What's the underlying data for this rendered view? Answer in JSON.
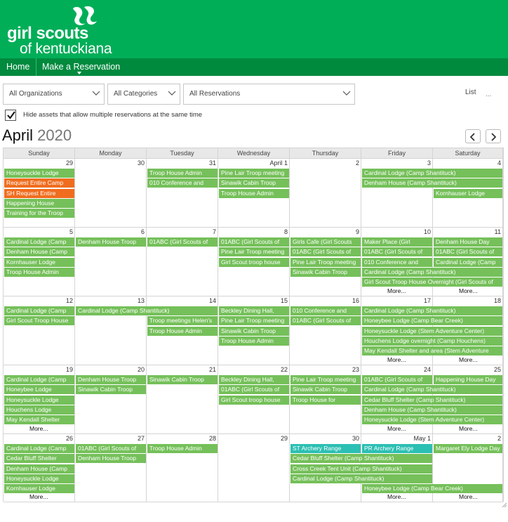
{
  "brand": {
    "line1": "girl scouts",
    "line2": "of kentuckiana"
  },
  "nav": {
    "home": "Home",
    "reserve": "Make a Reservation"
  },
  "filters": {
    "organizations": "All Organizations",
    "categories": "All Categories",
    "reservations": "All Reservations",
    "list": "List",
    "more_dots": "..."
  },
  "hide_assets": {
    "label": "Hide assets that allow multiple reservations at the same time",
    "checked": true
  },
  "month": {
    "name": "April",
    "year": "2020"
  },
  "colors": {
    "header": "#00ae58",
    "nav": "#008a3e",
    "event": "#75c05a",
    "event_alert": "#f06d1f",
    "event_teal": "#2cbfb3"
  },
  "days": [
    "Sunday",
    "Monday",
    "Tuesday",
    "Wednesday",
    "Thursday",
    "Friday",
    "Saturday"
  ],
  "weeks": [
    {
      "dates": [
        "29",
        "30",
        "31",
        "April 1",
        "2",
        "3",
        "4"
      ],
      "events": [
        {
          "c": 0,
          "s": 1,
          "r": 0,
          "t": "Honeysuckle Lodge",
          "k": "g"
        },
        {
          "c": 0,
          "s": 1,
          "r": 1,
          "t": "Request Entire Camp",
          "k": "o"
        },
        {
          "c": 0,
          "s": 1,
          "r": 2,
          "t": "SH Request Entire",
          "k": "o"
        },
        {
          "c": 0,
          "s": 1,
          "r": 3,
          "t": "Happening House",
          "k": "g"
        },
        {
          "c": 0,
          "s": 1,
          "r": 4,
          "t": "Training for the Troop",
          "k": "g"
        },
        {
          "c": 2,
          "s": 1,
          "r": 0,
          "t": "Troop House Admin",
          "k": "g"
        },
        {
          "c": 2,
          "s": 1,
          "r": 1,
          "t": "010 Conference and",
          "k": "g"
        },
        {
          "c": 3,
          "s": 1,
          "r": 0,
          "t": "Pine Lair Troop meeting",
          "k": "g"
        },
        {
          "c": 3,
          "s": 1,
          "r": 1,
          "t": "Sinawik Cabin Troop",
          "k": "g"
        },
        {
          "c": 3,
          "s": 1,
          "r": 2,
          "t": "Troop House Admin",
          "k": "g"
        },
        {
          "c": 5,
          "s": 2,
          "r": 0,
          "t": "Cardinal Lodge (Camp Shantituck)",
          "k": "g"
        },
        {
          "c": 5,
          "s": 2,
          "r": 1,
          "t": "Denham House (Camp Shantituck)",
          "k": "g"
        },
        {
          "c": 6,
          "s": 1,
          "r": 2,
          "t": "Kornhauser Lodge",
          "k": "g"
        }
      ],
      "more": []
    },
    {
      "dates": [
        "5",
        "6",
        "7",
        "8",
        "9",
        "10",
        "11"
      ],
      "events": [
        {
          "c": 0,
          "s": 1,
          "r": 0,
          "t": "Cardinal Lodge (Camp",
          "k": "g"
        },
        {
          "c": 0,
          "s": 1,
          "r": 1,
          "t": "Denham House (Camp",
          "k": "g"
        },
        {
          "c": 0,
          "s": 1,
          "r": 2,
          "t": "Kornhauser Lodge",
          "k": "g"
        },
        {
          "c": 0,
          "s": 1,
          "r": 3,
          "t": "Troop House Admin",
          "k": "g"
        },
        {
          "c": 1,
          "s": 1,
          "r": 0,
          "t": "Denham House Troop",
          "k": "g"
        },
        {
          "c": 2,
          "s": 1,
          "r": 0,
          "t": "01ABC (Girl Scouts of",
          "k": "g"
        },
        {
          "c": 3,
          "s": 1,
          "r": 0,
          "t": "01ABC (Girl Scouts of",
          "k": "g"
        },
        {
          "c": 3,
          "s": 1,
          "r": 1,
          "t": "Pine Lair Troop meeting",
          "k": "g"
        },
        {
          "c": 3,
          "s": 1,
          "r": 2,
          "t": "Girl Scout troop house",
          "k": "g"
        },
        {
          "c": 4,
          "s": 1,
          "r": 0,
          "t": "Girls Cafe (Girl Scouts",
          "k": "g"
        },
        {
          "c": 4,
          "s": 1,
          "r": 1,
          "t": "01ABC (Girl Scouts of",
          "k": "g"
        },
        {
          "c": 4,
          "s": 1,
          "r": 2,
          "t": "Pine Lair Troop meeting",
          "k": "g"
        },
        {
          "c": 4,
          "s": 1,
          "r": 3,
          "t": "Sinawik Cabin Troop",
          "k": "g"
        },
        {
          "c": 5,
          "s": 1,
          "r": 0,
          "t": "Maker Place (Girl",
          "k": "g"
        },
        {
          "c": 5,
          "s": 1,
          "r": 1,
          "t": "01ABC (Girl Scouts of",
          "k": "g"
        },
        {
          "c": 5,
          "s": 1,
          "r": 2,
          "t": "010 Conference and",
          "k": "g"
        },
        {
          "c": 5,
          "s": 2,
          "r": 3,
          "t": "Cardinal Lodge (Camp Shantituck)",
          "k": "g"
        },
        {
          "c": 5,
          "s": 2,
          "r": 4,
          "t": "Girl Scout Troop House Overnight (Girl Scouts of",
          "k": "g"
        },
        {
          "c": 6,
          "s": 1,
          "r": 0,
          "t": "Denham House Day",
          "k": "g"
        },
        {
          "c": 6,
          "s": 1,
          "r": 1,
          "t": "01ABC (Girl Scouts of",
          "k": "g"
        },
        {
          "c": 6,
          "s": 1,
          "r": 2,
          "t": "Cardinal Lodge (Camp",
          "k": "g"
        }
      ],
      "more": [
        {
          "c": 5,
          "t": "More..."
        },
        {
          "c": 6,
          "t": "More..."
        }
      ]
    },
    {
      "dates": [
        "12",
        "13",
        "14",
        "15",
        "16",
        "17",
        "18"
      ],
      "events": [
        {
          "c": 0,
          "s": 1,
          "r": 0,
          "t": "Cardinal Lodge (Camp",
          "k": "g"
        },
        {
          "c": 0,
          "s": 1,
          "r": 1,
          "t": "Girl Scout Troop House",
          "k": "g"
        },
        {
          "c": 1,
          "s": 2,
          "r": 0,
          "t": "Cardinal Lodge (Camp Shantituck)",
          "k": "g"
        },
        {
          "c": 2,
          "s": 1,
          "r": 1,
          "t": "Troop meetings Helen's",
          "k": "g"
        },
        {
          "c": 2,
          "s": 1,
          "r": 2,
          "t": "Troop House Admin",
          "k": "g"
        },
        {
          "c": 3,
          "s": 1,
          "r": 0,
          "t": "Beckley Dining Hall,",
          "k": "g"
        },
        {
          "c": 3,
          "s": 1,
          "r": 1,
          "t": "Pine Lair Troop meeting",
          "k": "g"
        },
        {
          "c": 3,
          "s": 1,
          "r": 2,
          "t": "Sinawik Cabin Troop",
          "k": "g"
        },
        {
          "c": 3,
          "s": 1,
          "r": 3,
          "t": "Troop House Admin",
          "k": "g"
        },
        {
          "c": 4,
          "s": 1,
          "r": 0,
          "t": "010 Conference and",
          "k": "g"
        },
        {
          "c": 4,
          "s": 1,
          "r": 1,
          "t": "01ABC (Girl Scouts of",
          "k": "g"
        },
        {
          "c": 5,
          "s": 2,
          "r": 0,
          "t": "Cardinal Lodge (Camp Shantituck)",
          "k": "g"
        },
        {
          "c": 5,
          "s": 2,
          "r": 1,
          "t": "Honeybee Lodge (Camp Bear Creek)",
          "k": "g"
        },
        {
          "c": 5,
          "s": 2,
          "r": 2,
          "t": "Honeysuckle Lodge (Stem Adventure Center)",
          "k": "g"
        },
        {
          "c": 5,
          "s": 2,
          "r": 3,
          "t": "Houchens Lodge overnight (Camp Houchens)",
          "k": "g"
        },
        {
          "c": 5,
          "s": 2,
          "r": 4,
          "t": "May Kendall Shelter and area (Stem Adventure",
          "k": "g"
        }
      ],
      "more": [
        {
          "c": 5,
          "t": "More..."
        },
        {
          "c": 6,
          "t": "More..."
        }
      ]
    },
    {
      "dates": [
        "19",
        "20",
        "21",
        "22",
        "23",
        "24",
        "25"
      ],
      "events": [
        {
          "c": 0,
          "s": 1,
          "r": 0,
          "t": "Cardinal Lodge (Camp",
          "k": "g"
        },
        {
          "c": 0,
          "s": 1,
          "r": 1,
          "t": "Honeybee Lodge",
          "k": "g"
        },
        {
          "c": 0,
          "s": 1,
          "r": 2,
          "t": "Honeysuckle Lodge",
          "k": "g"
        },
        {
          "c": 0,
          "s": 1,
          "r": 3,
          "t": "Houchens Lodge",
          "k": "g"
        },
        {
          "c": 0,
          "s": 1,
          "r": 4,
          "t": "May Kendall Shelter",
          "k": "g"
        },
        {
          "c": 1,
          "s": 1,
          "r": 0,
          "t": "Denham House Troop",
          "k": "g"
        },
        {
          "c": 1,
          "s": 1,
          "r": 1,
          "t": "Sinawik Cabin Troop",
          "k": "g"
        },
        {
          "c": 2,
          "s": 1,
          "r": 0,
          "t": "Sinawik Cabin Troop",
          "k": "g"
        },
        {
          "c": 3,
          "s": 1,
          "r": 0,
          "t": "Beckley Dining Hall,",
          "k": "g"
        },
        {
          "c": 3,
          "s": 1,
          "r": 1,
          "t": "01ABC (Girl Scouts of",
          "k": "g"
        },
        {
          "c": 3,
          "s": 1,
          "r": 2,
          "t": "Girl Scout troop house",
          "k": "g"
        },
        {
          "c": 4,
          "s": 1,
          "r": 0,
          "t": "Pine Lair Troop meeting",
          "k": "g"
        },
        {
          "c": 4,
          "s": 1,
          "r": 1,
          "t": "Sinawik Cabin Troop",
          "k": "g"
        },
        {
          "c": 4,
          "s": 1,
          "r": 2,
          "t": "Troop House for",
          "k": "g"
        },
        {
          "c": 5,
          "s": 1,
          "r": 0,
          "t": "01ABC (Girl Scouts of",
          "k": "g"
        },
        {
          "c": 5,
          "s": 2,
          "r": 1,
          "t": "Cardinal Lodge (Camp Shantituck)",
          "k": "g"
        },
        {
          "c": 5,
          "s": 2,
          "r": 2,
          "t": "Cedar Bluff Shelter (Camp Shantituck)",
          "k": "g"
        },
        {
          "c": 5,
          "s": 2,
          "r": 3,
          "t": "Denham House (Camp Shantituck)",
          "k": "g"
        },
        {
          "c": 5,
          "s": 2,
          "r": 4,
          "t": "Honeysuckle Lodge (Stem Adventure Center)",
          "k": "g"
        },
        {
          "c": 6,
          "s": 1,
          "r": 0,
          "t": "Happening House Day",
          "k": "g"
        }
      ],
      "more": [
        {
          "c": 0,
          "t": "More..."
        },
        {
          "c": 5,
          "t": "More..."
        },
        {
          "c": 6,
          "t": "More..."
        }
      ]
    },
    {
      "dates": [
        "26",
        "27",
        "28",
        "29",
        "30",
        "May 1",
        "2"
      ],
      "events": [
        {
          "c": 0,
          "s": 1,
          "r": 0,
          "t": "Cardinal Lodge (Camp",
          "k": "g"
        },
        {
          "c": 0,
          "s": 1,
          "r": 1,
          "t": "Cedar Bluff Shelter",
          "k": "g"
        },
        {
          "c": 0,
          "s": 1,
          "r": 2,
          "t": "Denham House (Camp",
          "k": "g"
        },
        {
          "c": 0,
          "s": 1,
          "r": 3,
          "t": "Honeysuckle Lodge",
          "k": "g"
        },
        {
          "c": 0,
          "s": 1,
          "r": 4,
          "t": "Kornhauser Lodge",
          "k": "g"
        },
        {
          "c": 1,
          "s": 1,
          "r": 0,
          "t": "01ABC (Girl Scouts of",
          "k": "g"
        },
        {
          "c": 1,
          "s": 1,
          "r": 1,
          "t": "Denham House Troop",
          "k": "g"
        },
        {
          "c": 2,
          "s": 1,
          "r": 0,
          "t": "Troop House Admin",
          "k": "g"
        },
        {
          "c": 4,
          "s": 1,
          "r": 0,
          "t": "ST Archery Range",
          "k": "t"
        },
        {
          "c": 5,
          "s": 1,
          "r": 0,
          "t": "PR Archery Range",
          "k": "t"
        },
        {
          "c": 6,
          "s": 1,
          "r": 0,
          "t": "Margaret Ely Lodge Day",
          "k": "g"
        },
        {
          "c": 4,
          "s": 2,
          "r": 1,
          "t": "Cedar Bluff Shelter (Camp Shantituck)",
          "k": "g"
        },
        {
          "c": 4,
          "s": 2,
          "r": 2,
          "t": "Cross Creek Tent Unit (Camp Shantituck)",
          "k": "g"
        },
        {
          "c": 4,
          "s": 2,
          "r": 3,
          "t": "Cardinal Lodge (Camp Shantituck)",
          "k": "g"
        },
        {
          "c": 5,
          "s": 2,
          "r": 4,
          "t": "Honeybee Lodge (Camp Bear Creek)",
          "k": "g"
        }
      ],
      "more": [
        {
          "c": 0,
          "t": "More..."
        },
        {
          "c": 5,
          "t": "More..."
        },
        {
          "c": 6,
          "t": "More..."
        }
      ]
    }
  ]
}
